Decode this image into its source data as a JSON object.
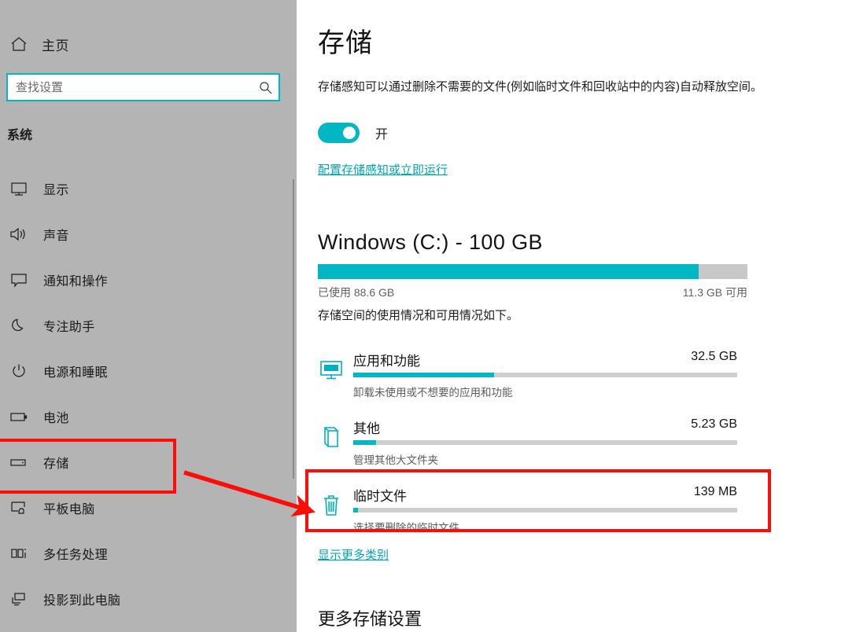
{
  "sidebar": {
    "home": {
      "label": "主页",
      "icon": "home-icon"
    },
    "search": {
      "placeholder": "查找设置",
      "value": "",
      "icon": "search-icon"
    },
    "section_title": "系统",
    "items": [
      {
        "label": "显示",
        "icon": "monitor-icon"
      },
      {
        "label": "声音",
        "icon": "speaker-icon"
      },
      {
        "label": "通知和操作",
        "icon": "notification-icon"
      },
      {
        "label": "专注助手",
        "icon": "moon-icon"
      },
      {
        "label": "电源和睡眠",
        "icon": "power-icon"
      },
      {
        "label": "电池",
        "icon": "battery-icon"
      },
      {
        "label": "存储",
        "icon": "storage-icon"
      },
      {
        "label": "平板电脑",
        "icon": "tablet-icon"
      },
      {
        "label": "多任务处理",
        "icon": "multitasking-icon"
      },
      {
        "label": "投影到此电脑",
        "icon": "project-icon"
      }
    ]
  },
  "main": {
    "title": "存储",
    "intro": "存储感知可以通过删除不需要的文件(例如临时文件和回收站中的内容)自动释放空间。",
    "storage_sense": {
      "state_label": "开",
      "on": true
    },
    "configure_link": "配置存储感知或立即运行",
    "drive": {
      "title": "Windows (C:) - 100 GB",
      "used_label": "已使用 88.6 GB",
      "free_label": "11.3 GB 可用",
      "used_percent": 88.6,
      "description": "存储空间的使用情况和可用情况如下。"
    },
    "categories": [
      {
        "name": "应用和功能",
        "size": "32.5 GB",
        "percent": 36.7,
        "description": "卸载未使用或不想要的应用和功能",
        "icon": "apps-monitor-icon",
        "highlighted": false
      },
      {
        "name": "其他",
        "size": "5.23 GB",
        "percent": 5.9,
        "description": "管理其他大文件夹",
        "icon": "folder-icon",
        "highlighted": false
      },
      {
        "name": "临时文件",
        "size": "139 MB",
        "percent": 1.2,
        "description": "选择要删除的临时文件",
        "icon": "trash-icon",
        "highlighted": true
      }
    ],
    "show_more_link": "显示更多类别",
    "more_settings_title": "更多存储设置"
  },
  "annotations": {
    "box_color": "#FC0D08",
    "arrow_color": "#FC0D08",
    "boxes": [
      "sidebar-storage-item",
      "temporary-files-row"
    ],
    "arrow": "points from sidebar storage box to temporary files row"
  },
  "colors": {
    "accent": "#00B7C3",
    "link": "#00A6B4",
    "sidebar_bg": "#B4B4B4",
    "main_bg": "#FFFFFF",
    "track": "#C8C8C8",
    "annotation_red": "#FC0D08"
  }
}
